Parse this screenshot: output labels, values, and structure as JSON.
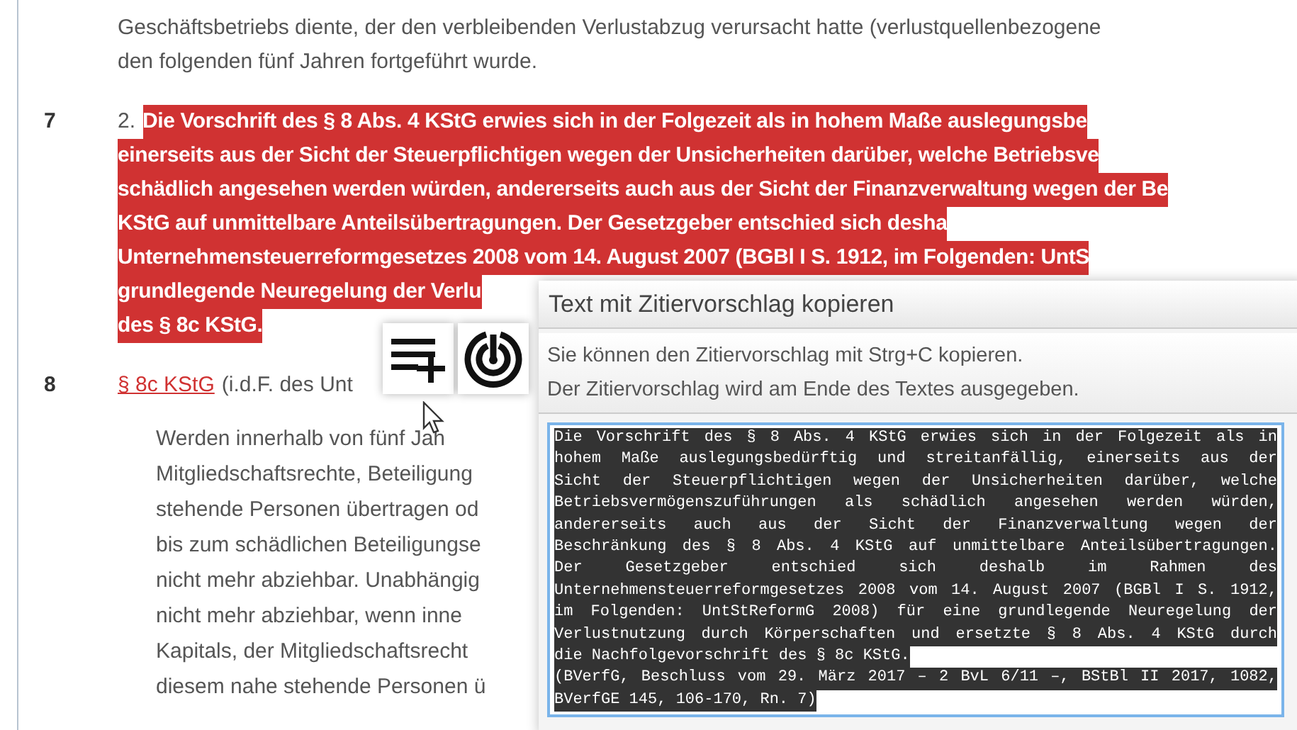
{
  "document": {
    "intro_lines": [
      "Geschäftsbetriebs diente, der den verbleibenden Verlustabzug verursacht hatte (verlustquellenbezogene",
      "den folgenden fünf Jahren fortgeführt wurde."
    ],
    "paragraphs": [
      {
        "number": "7",
        "list_marker": "2.",
        "highlighted": true,
        "lines": [
          "Die Vorschrift des § 8 Abs. 4 KStG erwies sich in der Folgezeit als in hohem Maße auslegungsbe",
          "einerseits aus der Sicht der Steuerpflichtigen wegen der Unsicherheiten darüber, welche Betriebsve",
          "schädlich angesehen werden würden, andererseits auch aus der Sicht der Finanzverwaltung wegen der Be",
          "KStG auf unmittelbare Anteilsübertragungen. Der Gesetzgeber entschied sich desha",
          "Unternehmensteuerreformgesetzes 2008 vom 14. August 2007 (BGBl I S. 1912, im Folgenden: UntS",
          "grundlegende Neuregelung der Verlu",
          "des § 8c KStG."
        ]
      },
      {
        "number": "8",
        "link": "§ 8c KStG",
        "heading_rest": "(i.d.F. des Unt",
        "highlighted": false,
        "lines": [
          "Werden innerhalb von fünf Jah",
          "Mitgliedschaftsrechte, Beteiligung",
          "stehende Personen übertragen od",
          "bis zum schädlichen Beteiligungse",
          "nicht mehr abziehbar. Unabhängig",
          "nicht mehr abziehbar, wenn inne",
          "Kapitals, der Mitgliedschaftsrecht",
          "diesem nahe stehende Personen ü"
        ]
      }
    ]
  },
  "toolbar": {
    "buttons": [
      {
        "kind": "add-to-list"
      },
      {
        "kind": "cite"
      }
    ]
  },
  "dialog": {
    "title": "Text mit Zitiervorschlag kopieren",
    "info_lines": [
      "Sie können den Zitiervorschlag mit Strg+C kopieren.",
      "Der Zitiervorschlag wird am Ende des Textes ausgegeben."
    ],
    "textarea": {
      "selected": true,
      "paragraphs": [
        [
          "Die Vorschrift des § 8 Abs. 4 KStG erwies sich in der Folgezeit als in",
          "hohem Maße auslegungsbedürftig und streitanfällig, einerseits aus der",
          "Sicht der Steuerpflichtigen wegen der Unsicherheiten darüber, welche",
          "Betriebsvermögenszuführungen als schädlich angesehen werden würden,",
          "andererseits auch aus der Sicht der Finanzverwaltung wegen der",
          "Beschränkung des § 8 Abs. 4 KStG auf unmittelbare Anteilsübertragungen.",
          "Der Gesetzgeber entschied sich deshalb im Rahmen des",
          "Unternehmensteuerreformgesetzes 2008 vom 14. August 2007 (BGBl I S. 1912,",
          "im Folgenden: UntStReformG 2008) für eine grundlegende Neuregelung der",
          "Verlustnutzung durch Körperschaften und ersetzte § 8 Abs. 4 KStG durch",
          "die Nachfolgevorschrift des § 8c KStG."
        ],
        [
          "(BVerfG, Beschluss vom 29. März 2017 – 2 BvL 6/11 –, BStBl II 2017, 1082,",
          "BVerfGE 145, 106-170, Rn. 7)"
        ]
      ]
    }
  }
}
